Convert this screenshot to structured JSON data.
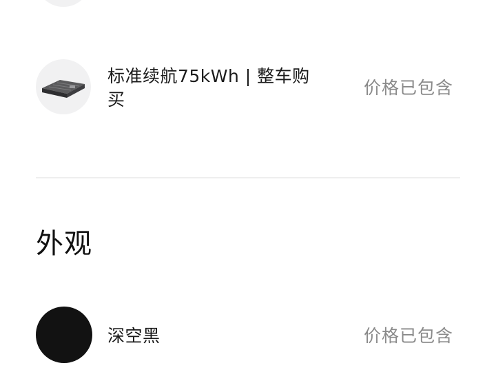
{
  "config": {
    "battery": {
      "icon": "battery-pack-icon",
      "label_line1": "标准续航75kWh | 整车购",
      "label_line2": "买",
      "price_note": "价格已包含"
    },
    "exterior": {
      "title": "外观",
      "color": {
        "name": "深空黑",
        "swatch_color": "#121212",
        "price_note": "价格已包含"
      }
    }
  }
}
